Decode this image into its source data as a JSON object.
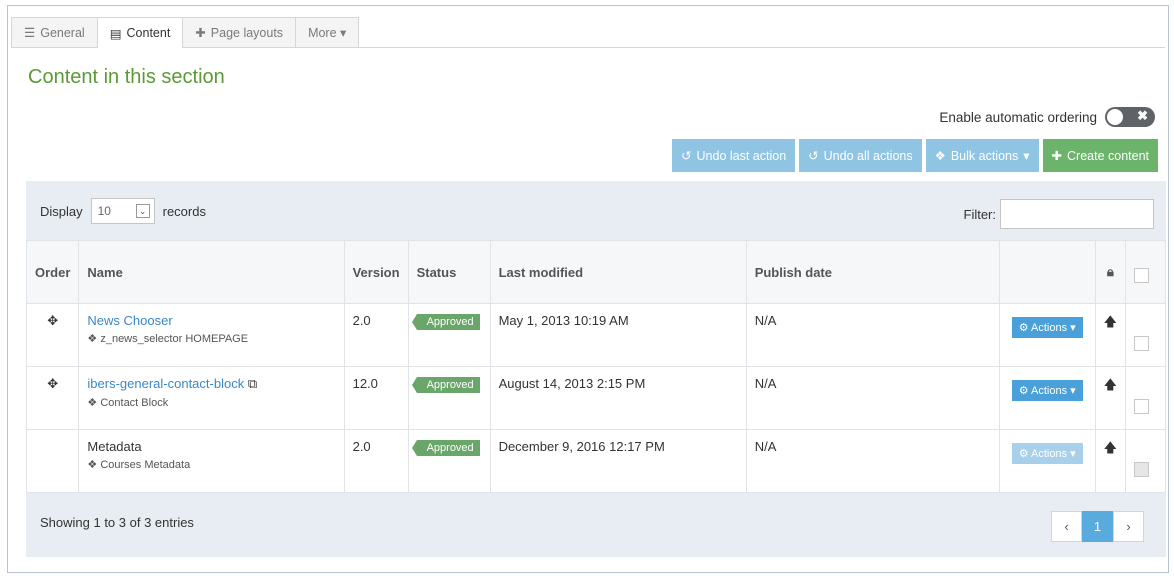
{
  "tabs": [
    {
      "label": "General",
      "icon": "sliders-icon"
    },
    {
      "label": "Content",
      "icon": "document-icon",
      "active": true
    },
    {
      "label": "Page layouts",
      "icon": "puzzle-icon"
    },
    {
      "label": "More ▾",
      "icon": ""
    }
  ],
  "page_title": "Content in this section",
  "auto_ordering": {
    "label": "Enable automatic ordering",
    "enabled": false
  },
  "toolbar": {
    "undo_last": "Undo last action",
    "undo_all": "Undo all actions",
    "bulk": "Bulk actions",
    "create": "Create content"
  },
  "display": {
    "label": "Display",
    "value": "10",
    "suffix": "records"
  },
  "filter": {
    "label": "Filter:",
    "value": ""
  },
  "columns": [
    "Order",
    "Name",
    "Version",
    "Status",
    "Last modified",
    "Publish date",
    "",
    ""
  ],
  "rows": [
    {
      "name": "News Chooser",
      "type": "z_news_selector HOMEPAGE",
      "version": "2.0",
      "status": "Approved",
      "modified": "May 1, 2013 10:19 AM",
      "publish": "N/A",
      "actions": "Actions"
    },
    {
      "name": "ibers-general-contact-block",
      "type": "Contact Block",
      "version": "12.0",
      "status": "Approved",
      "modified": "August 14, 2013 2:15 PM",
      "publish": "N/A",
      "actions": "Actions"
    },
    {
      "name": "Metadata",
      "type": "Courses Metadata",
      "version": "2.0",
      "status": "Approved",
      "modified": "December 9, 2016 12:17 PM",
      "publish": "N/A",
      "actions": "Actions"
    }
  ],
  "footer": {
    "summary": "Showing 1 to 3 of 3 entries",
    "page": "1",
    "prev": "‹",
    "next": "›"
  }
}
